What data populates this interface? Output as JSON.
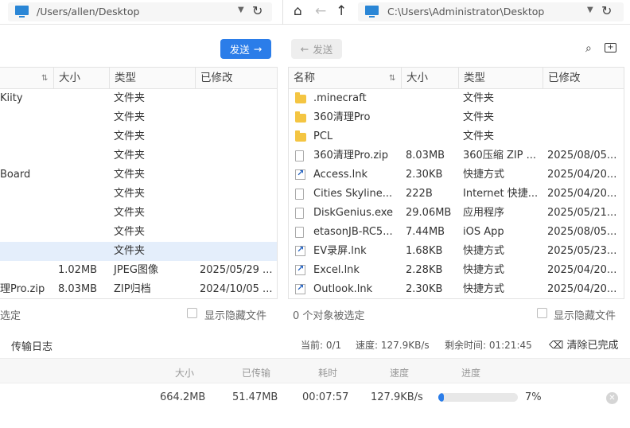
{
  "left_panel": {
    "path": "/Users/allen/Desktop",
    "send_label": "发送",
    "columns": [
      "大小",
      "类型",
      "已修改"
    ],
    "rows": [
      {
        "name": "Kiity",
        "size": "",
        "type": "文件夹",
        "modified": ""
      },
      {
        "name": "",
        "size": "",
        "type": "文件夹",
        "modified": ""
      },
      {
        "name": "",
        "size": "",
        "type": "文件夹",
        "modified": ""
      },
      {
        "name": "",
        "size": "",
        "type": "文件夹",
        "modified": ""
      },
      {
        "name": "Board",
        "size": "",
        "type": "文件夹",
        "modified": ""
      },
      {
        "name": "",
        "size": "",
        "type": "文件夹",
        "modified": ""
      },
      {
        "name": "",
        "size": "",
        "type": "文件夹",
        "modified": ""
      },
      {
        "name": "",
        "size": "",
        "type": "文件夹",
        "modified": ""
      },
      {
        "name": "",
        "size": "",
        "type": "文件夹",
        "modified": ""
      },
      {
        "name": "",
        "size": "1.02MB",
        "type": "JPEG图像",
        "modified": "2025/05/29 ..."
      },
      {
        "name": "理Pro.zip",
        "size": "8.03MB",
        "type": "ZIP归档",
        "modified": "2024/10/05 ..."
      }
    ],
    "status": "选定",
    "show_hidden_label": "显示隐藏文件"
  },
  "right_panel": {
    "path": "C:\\Users\\Administrator\\Desktop",
    "send_label": "发送",
    "columns": [
      "名称",
      "大小",
      "类型",
      "已修改"
    ],
    "rows": [
      {
        "name": ".minecraft",
        "size": "",
        "type": "文件夹",
        "modified": "",
        "icon": "folder"
      },
      {
        "name": "360清理Pro",
        "size": "",
        "type": "文件夹",
        "modified": "",
        "icon": "folder"
      },
      {
        "name": "PCL",
        "size": "",
        "type": "文件夹",
        "modified": "",
        "icon": "folder"
      },
      {
        "name": "360清理Pro.zip",
        "size": "8.03MB",
        "type": "360压缩 ZIP ...",
        "modified": "2025/08/05...",
        "icon": "doc"
      },
      {
        "name": "Access.lnk",
        "size": "2.30KB",
        "type": "快捷方式",
        "modified": "2025/04/20...",
        "icon": "lnk"
      },
      {
        "name": "Cities Skyline...",
        "size": "222B",
        "type": "Internet 快捷...",
        "modified": "2025/04/20...",
        "icon": "doc"
      },
      {
        "name": "DiskGenius.exe",
        "size": "29.06MB",
        "type": "应用程序",
        "modified": "2025/05/21...",
        "icon": "doc"
      },
      {
        "name": "etasonJB-RC5...",
        "size": "7.44MB",
        "type": "iOS App",
        "modified": "2025/08/05...",
        "icon": "doc"
      },
      {
        "name": "EV录屏.lnk",
        "size": "1.68KB",
        "type": "快捷方式",
        "modified": "2025/05/23...",
        "icon": "lnk"
      },
      {
        "name": "Excel.lnk",
        "size": "2.28KB",
        "type": "快捷方式",
        "modified": "2025/04/20...",
        "icon": "lnk"
      },
      {
        "name": "Outlook.lnk",
        "size": "2.30KB",
        "type": "快捷方式",
        "modified": "2025/04/20...",
        "icon": "lnk"
      }
    ],
    "status": "0 个对象被选定",
    "show_hidden_label": "显示隐藏文件"
  },
  "transfer_log": {
    "title": "传输日志",
    "current": "当前: 0/1",
    "speed": "速度: 127.9KB/s",
    "remaining": "剩余时间: 01:21:45",
    "clear_label": "清除已完成",
    "headers": [
      "大小",
      "已传输",
      "耗时",
      "速度",
      "进度"
    ],
    "entry": {
      "size": "664.2MB",
      "transferred": "51.47MB",
      "elapsed": "00:07:57",
      "speed": "127.9KB/s",
      "progress_pct": "7%",
      "progress_value": 7
    }
  },
  "colors": {
    "accent": "#2b7de9",
    "selected_row": "#e4eefb"
  }
}
